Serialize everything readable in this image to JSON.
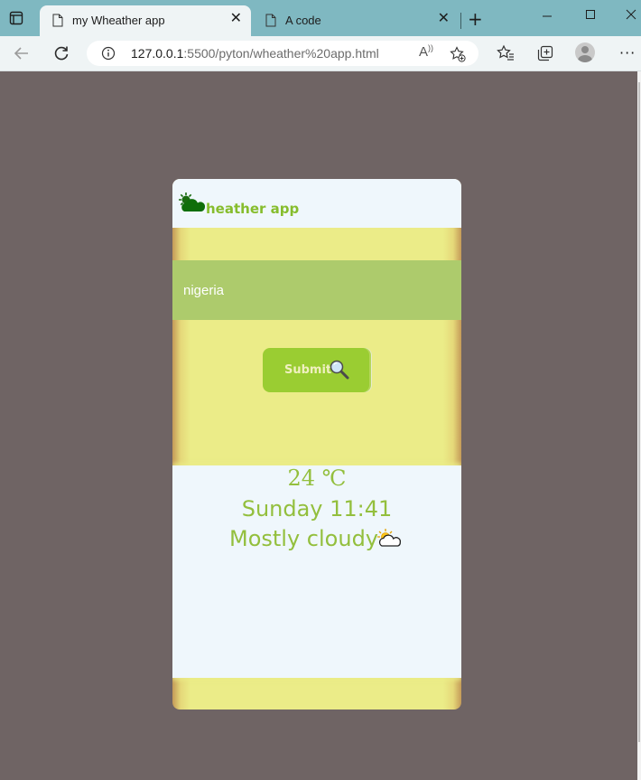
{
  "browser": {
    "tabs": [
      {
        "label": "my Wheather app",
        "active": true
      },
      {
        "label": "A code",
        "active": false
      }
    ],
    "url_host": "127.0.0.1",
    "url_rest": ":5500/pyton/wheather%20app.html"
  },
  "app": {
    "title": "heather app",
    "search": {
      "value": "nigeria"
    },
    "submit_label": "Submit",
    "weather": {
      "temperature": "24",
      "unit": "℃",
      "datetime": "Sunday 11:41",
      "condition": "Mostly cloudy"
    }
  },
  "colors": {
    "page_bg": "#6f6464",
    "card_bg": "#ebec88",
    "input_bg": "#adcb6c",
    "accent_green": "#9acd32",
    "text_green": "#93bf3d",
    "panel_bg": "#eff7fc"
  },
  "icons": [
    "tab-actions-icon",
    "page-icon",
    "close-icon",
    "plus-icon",
    "minimize-icon",
    "maximize-icon",
    "window-close-icon",
    "back-icon",
    "refresh-icon",
    "info-icon",
    "read-aloud-icon",
    "add-favorite-icon",
    "favorites-icon",
    "collections-icon",
    "profile-avatar",
    "more-icon",
    "weather-logo-icon",
    "magnifier-icon",
    "cloud-sun-icon"
  ]
}
